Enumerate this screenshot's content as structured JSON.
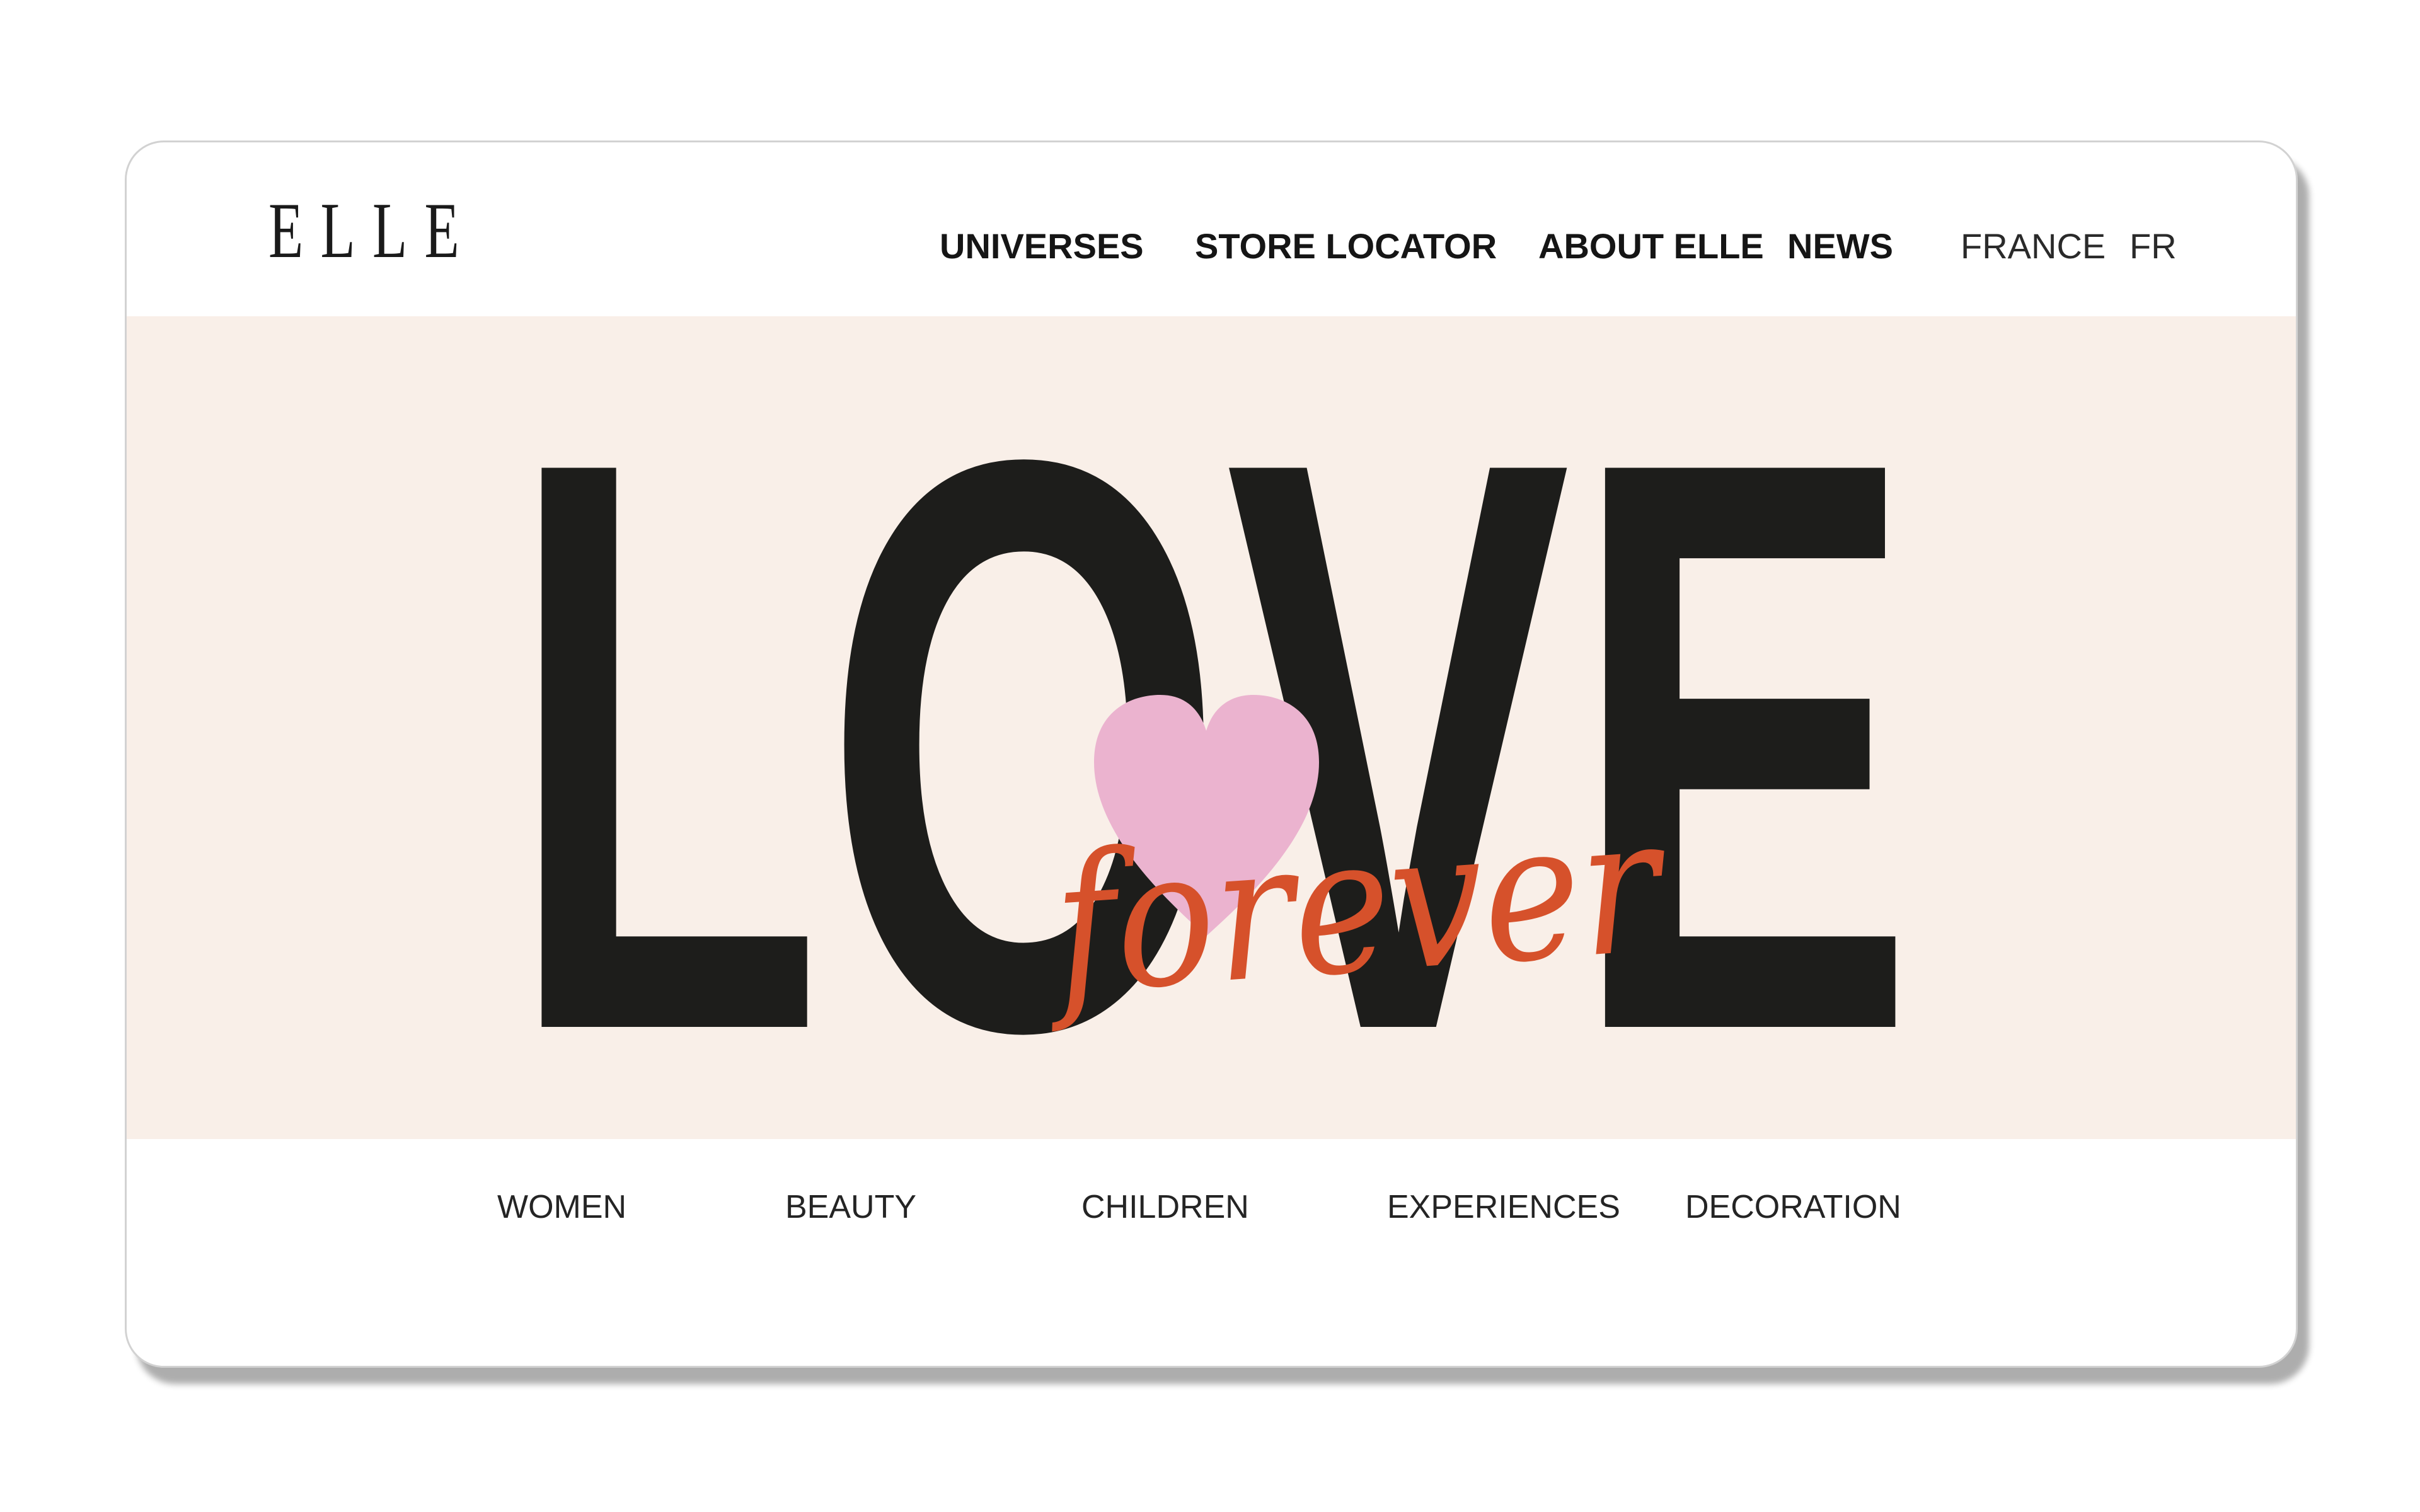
{
  "brand": {
    "logo_text": "ELLE"
  },
  "nav": {
    "items": [
      {
        "label": "UNIVERSES"
      },
      {
        "label": "STORE LOCATOR"
      },
      {
        "label": "ABOUT ELLE"
      },
      {
        "label": "NEWS"
      }
    ],
    "country": "FRANCE",
    "language": "FR"
  },
  "hero": {
    "headline": "LOVE",
    "script_text": "forever",
    "background_color": "#f9efe8",
    "headline_color": "#1d1d1b",
    "script_color": "#d6512b",
    "heart_color": "#ebb3cf"
  },
  "categories": [
    {
      "label": "WOMEN"
    },
    {
      "label": "BEAUTY"
    },
    {
      "label": "CHILDREN"
    },
    {
      "label": "EXPERIENCES"
    },
    {
      "label": "DECORATION"
    }
  ]
}
